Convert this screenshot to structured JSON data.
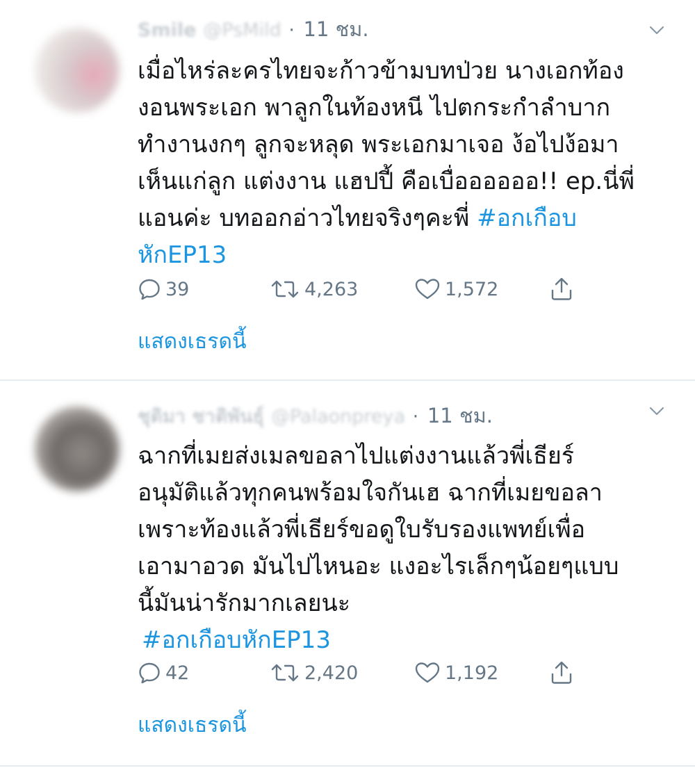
{
  "tweets": [
    {
      "display_name": "Smile",
      "handle": "@PsMild",
      "separator": "·",
      "time": "11 ชม.",
      "lines": [
        "เมื่อไหร่ละครไทยจะก้าวข้ามบทป่วย นางเอกท้อง",
        "งอนพระเอก พาลูกในท้องหนี ไปตกระกำลำบาก",
        "ทำงานงกๆ ลูกจะหลุด พระเอกมาเจอ ง้อไปง้อมา",
        "เห็นแก่ลูก แต่งงาน แฮปปี้ คือเบื่ออออออ!! ep.นี่พี่",
        "แอนค่ะ บทออกอ่าวไทยจริงๆคะพี่ "
      ],
      "hashtag_part1": "#อกเกือบ",
      "hashtag_part2": "หักEP13",
      "replies": "39",
      "retweets": "4,263",
      "likes": "1,572",
      "show_thread": "แสดงเธรดนี้"
    },
    {
      "display_name": "ชุติมา ชาติพันธุ์",
      "handle": "@Palaonpreya",
      "separator": "·",
      "time": "11 ชม.",
      "lines": [
        "ฉากที่เมยส่งเมลขอลาไปแต่งงานแล้วพี่เธียร์",
        "อนุมัติแล้วทุกคนพร้อมใจกันเฮ ฉากที่เมยขอลา",
        "เพราะท้องแล้วพี่เธียร์ขอดูใบรับรองแพทย์เพื่อ",
        "เอามาอวด มันไปไหนอะ แงอะไรเล็กๆน้อยๆแบบ",
        "นี้มันน่ารักมากเลยนะ"
      ],
      "hashtag": "#อกเกือบหักEP13",
      "replies": "42",
      "retweets": "2,420",
      "likes": "1,192",
      "show_thread": "แสดงเธรดนี้"
    }
  ],
  "icons": {
    "reply": "reply-icon",
    "retweet": "retweet-icon",
    "like": "heart-icon",
    "share": "share-icon",
    "menu": "chevron-down-icon"
  },
  "colors": {
    "link": "#1b95e0",
    "muted": "#657786",
    "text": "#14171a",
    "divider": "#e6ecf0"
  }
}
